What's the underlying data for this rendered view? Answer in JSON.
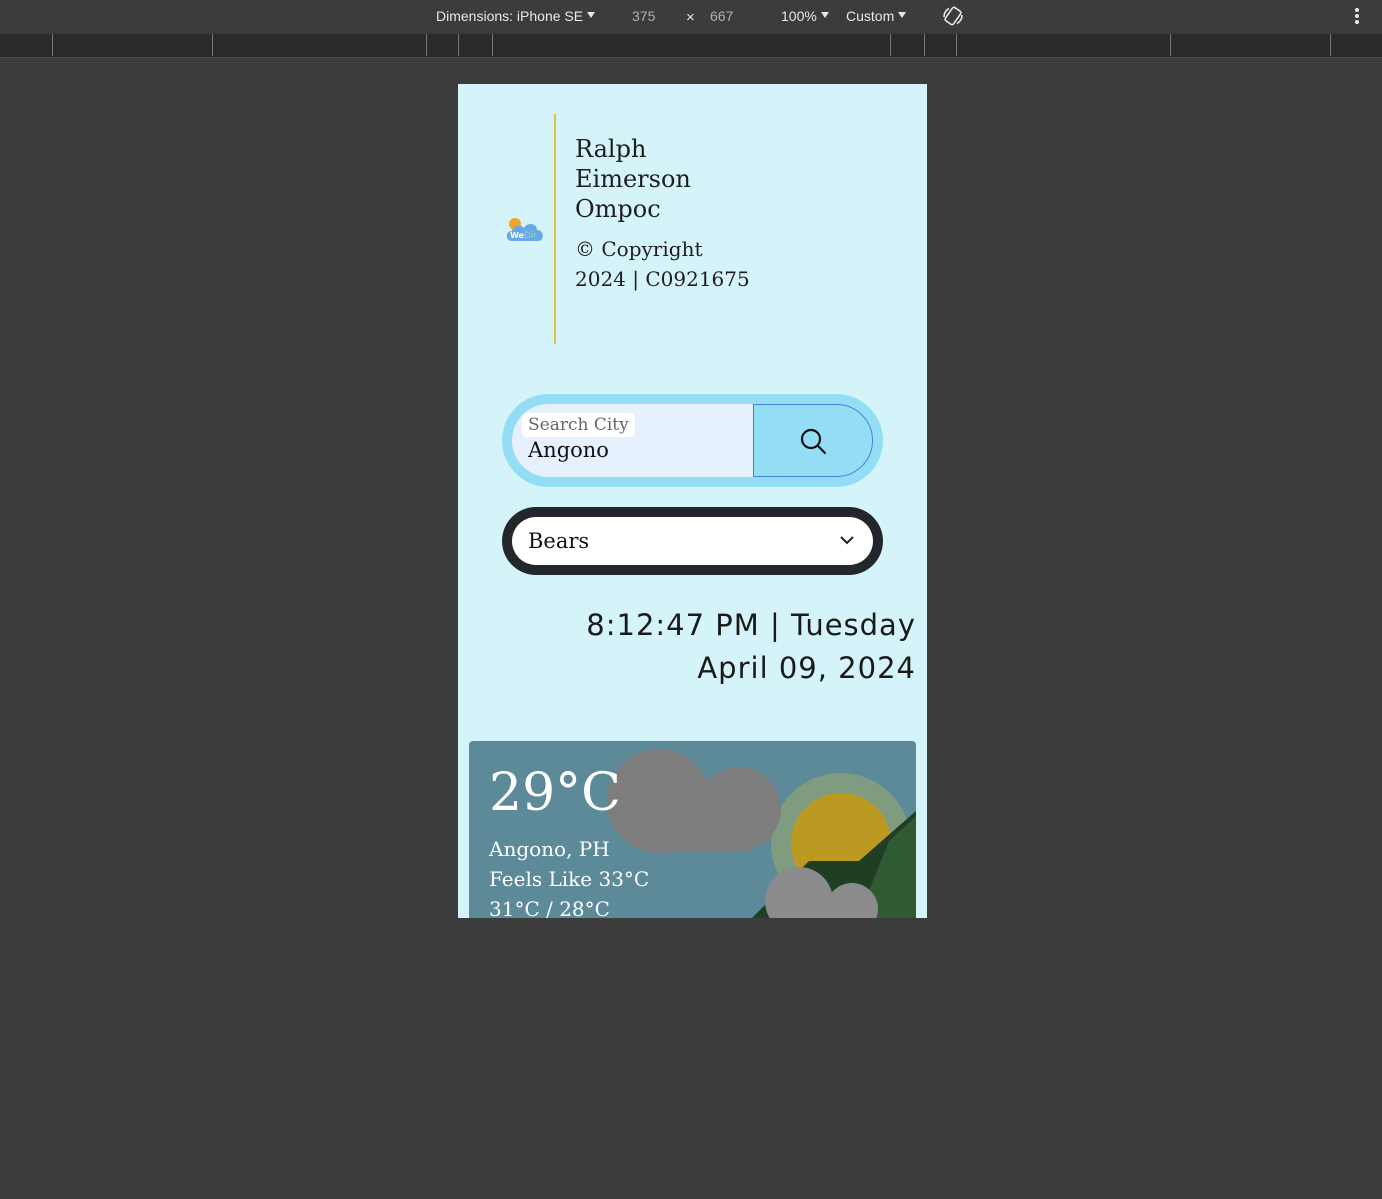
{
  "devtools": {
    "dimensions_label": "Dimensions: iPhone SE",
    "width_value": "375",
    "times": "×",
    "height_value": "667",
    "zoom": "100%",
    "throttle": "Custom"
  },
  "header": {
    "name": "Ralph Eimerson Ompoc",
    "copyright": "© Copyright 2024 | C0921675",
    "logo_text": "WeDir"
  },
  "search": {
    "label": "Search City",
    "value": "Angono",
    "button_icon": "search-icon"
  },
  "select": {
    "value": "Bears"
  },
  "clock": {
    "time_line": "8:12:47 PM | Tuesday",
    "date_line": "April 09, 2024"
  },
  "weather": {
    "temperature": "29°C",
    "location": "Angono, PH",
    "feels_like": "Feels Like 33°C",
    "range": "31°C / 28°C",
    "icon": "partly-cloudy-icon"
  },
  "colors": {
    "page_bg": "#d5f4fa",
    "search_bg": "#93def5",
    "accent_line": "#e0c44a",
    "card_bg": "#5c8a98"
  }
}
